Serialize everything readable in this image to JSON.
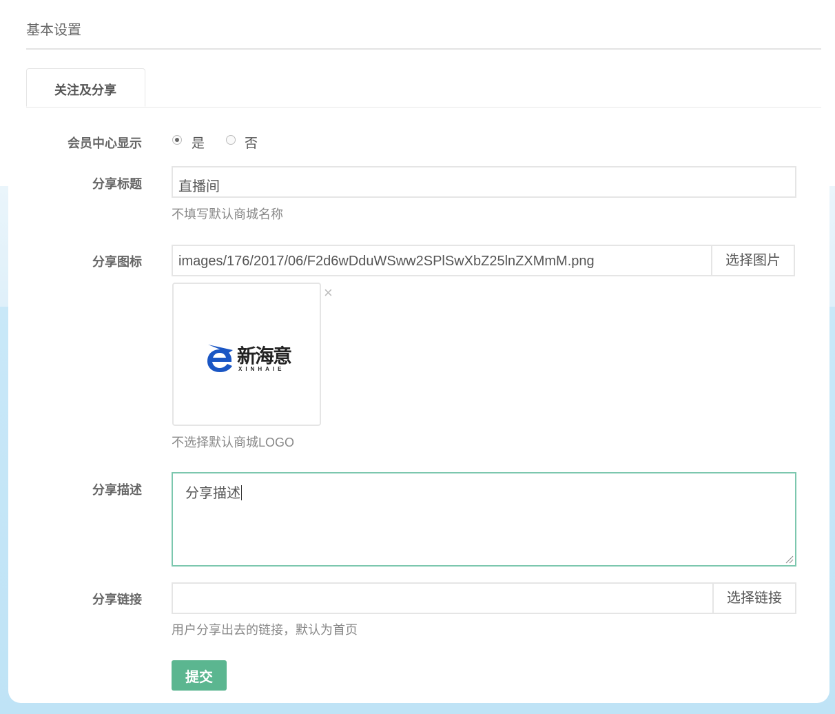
{
  "page": {
    "section_title": "基本设置",
    "tab_label": "关注及分享"
  },
  "member_center": {
    "label": "会员中心显示",
    "options": [
      {
        "label": "是",
        "selected": true
      },
      {
        "label": "否",
        "selected": false
      }
    ]
  },
  "share_title": {
    "label": "分享标题",
    "value": "直播间",
    "help": "不填写默认商城名称"
  },
  "share_icon": {
    "label": "分享图标",
    "value": "images/176/2017/06/F2d6wDduWSww2SPlSwXbZ25lnZXMmM.png",
    "button": "选择图片",
    "remove_symbol": "×",
    "preview_logo_text": "新海意",
    "preview_logo_subtext": "XINHAIE",
    "help": "不选择默认商城LOGO"
  },
  "share_description": {
    "label": "分享描述",
    "value": "分享描述"
  },
  "share_link": {
    "label": "分享链接",
    "value": "",
    "button": "选择链接",
    "help": "用户分享出去的链接，默认为首页"
  },
  "submit": {
    "label": "提交"
  },
  "colors": {
    "primary": "#5bb690",
    "focus_border": "#7cc7ae",
    "logo_blue": "#1a56c4"
  }
}
